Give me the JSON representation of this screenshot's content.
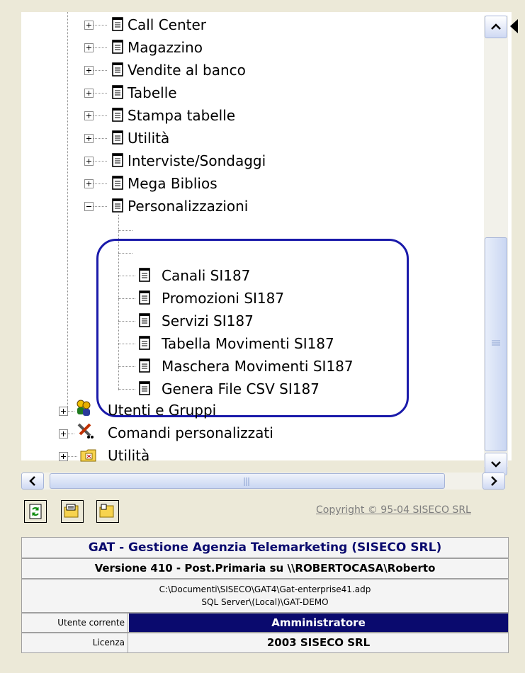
{
  "tree": {
    "top_items": [
      "Call Center",
      "Magazzino",
      "Vendite al banco",
      "Tabelle",
      "Stampa tabelle",
      "Utilità",
      "Interviste/Sondaggi",
      "Mega Biblios",
      "Personalizzazioni"
    ],
    "custom_items": [
      "Canali SI187",
      "Promozioni SI187",
      "Servizi SI187",
      "Tabella Movimenti SI187",
      "Maschera Movimenti SI187",
      "Genera File CSV SI187"
    ],
    "bottom_items": [
      "Utenti e Gruppi",
      "Comandi personalizzati",
      "Utilità"
    ]
  },
  "copyright": "Copyright © 95-04 SISECO SRL",
  "info": {
    "app_title": "GAT - Gestione Agenzia Telemarketing (SISECO SRL)",
    "version": "Versione 410 - Post.Primaria su \\\\ROBERTOCASA\\Roberto",
    "path_line1": "C:\\Documenti\\SISECO\\GAT4\\Gat-enterprise41.adp",
    "path_line2": "SQL Server\\(Local)\\GAT-DEMO",
    "user_label": "Utente corrente",
    "user_value": "Amministratore",
    "license_label": "Licenza",
    "license_value": "2003 SISECO SRL"
  },
  "colors": {
    "accent": "#0a0a6e",
    "highlight_border": "#1a1aaa",
    "window_bg": "#ece9d8"
  }
}
